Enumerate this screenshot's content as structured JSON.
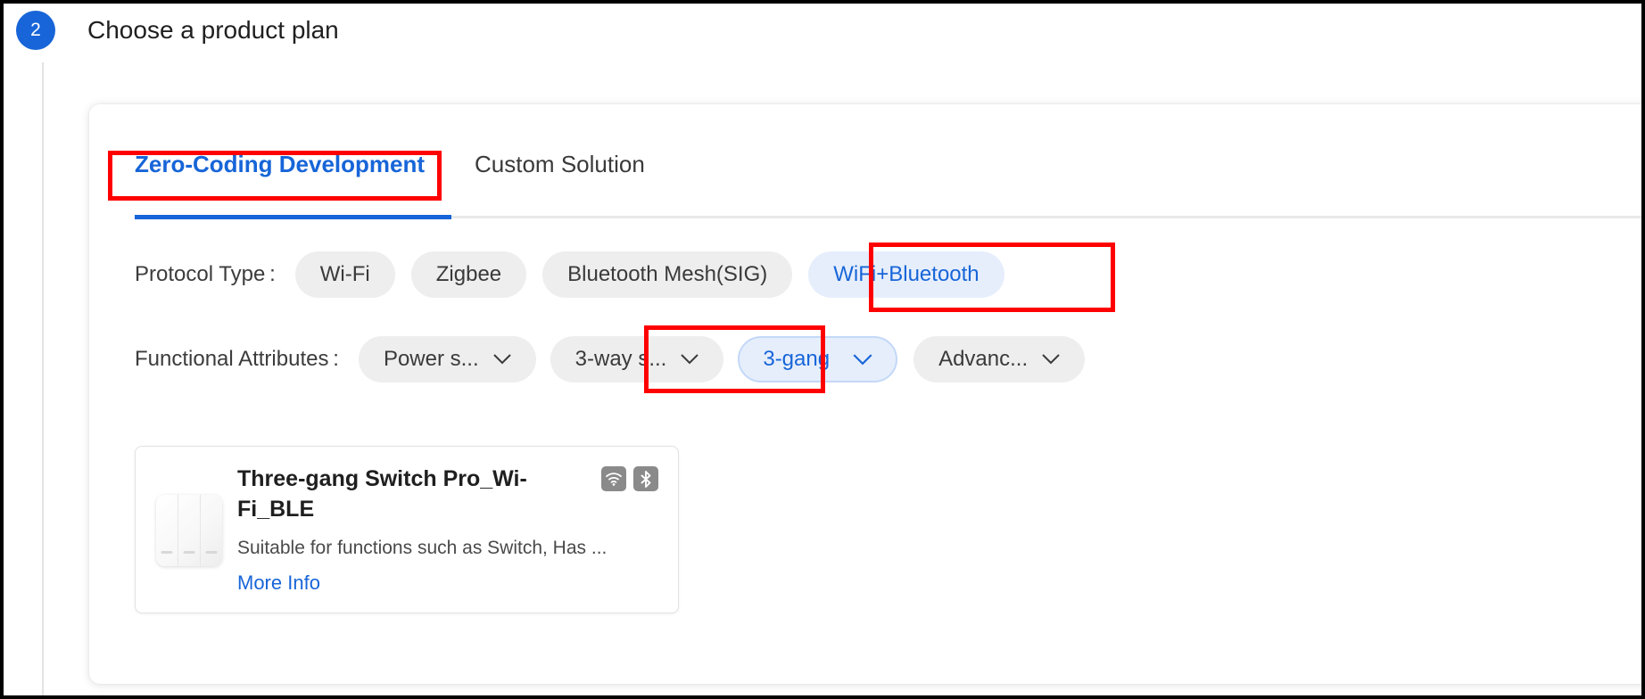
{
  "step": {
    "number": "2",
    "title": "Choose a product plan"
  },
  "tabs": [
    {
      "label": "Zero-Coding Development",
      "active": true
    },
    {
      "label": "Custom Solution",
      "active": false
    }
  ],
  "filters": {
    "protocol": {
      "label": "Protocol Type :",
      "options": [
        {
          "label": "Wi-Fi",
          "selected": false
        },
        {
          "label": "Zigbee",
          "selected": false
        },
        {
          "label": "Bluetooth Mesh(SIG)",
          "selected": false
        },
        {
          "label": "WiFi+Bluetooth",
          "selected": true
        }
      ]
    },
    "attributes": {
      "label": "Functional Attributes :",
      "options": [
        {
          "label": "Power s...",
          "selected": false,
          "caret": "chevron-down-icon"
        },
        {
          "label": "3-way s...",
          "selected": false,
          "caret": "chevron-down-icon"
        },
        {
          "label": "3-gang",
          "selected": true,
          "caret": "chevron-down-icon"
        },
        {
          "label": "Advanc...",
          "selected": false,
          "caret": "chevron-down-icon"
        }
      ]
    }
  },
  "product": {
    "title": "Three-gang Switch Pro_Wi-Fi_BLE",
    "description": "Suitable for functions such as Switch,  Has ...",
    "more_info_label": "More Info",
    "thumbnail_icon": "three-gang-switch-image",
    "badges": [
      {
        "name": "wifi-icon"
      },
      {
        "name": "bluetooth-icon"
      }
    ]
  },
  "annotations": {
    "highlight_color": "#ff0000",
    "boxes": [
      {
        "name": "highlight-box-zero-coding-tab"
      },
      {
        "name": "highlight-box-wifi-bluetooth-chip"
      },
      {
        "name": "highlight-box-3-gang-chip"
      }
    ]
  },
  "colors": {
    "accent": "#1765d8",
    "chip_bg": "#eeeeee",
    "chip_selected_bg": "#e6eefc"
  }
}
